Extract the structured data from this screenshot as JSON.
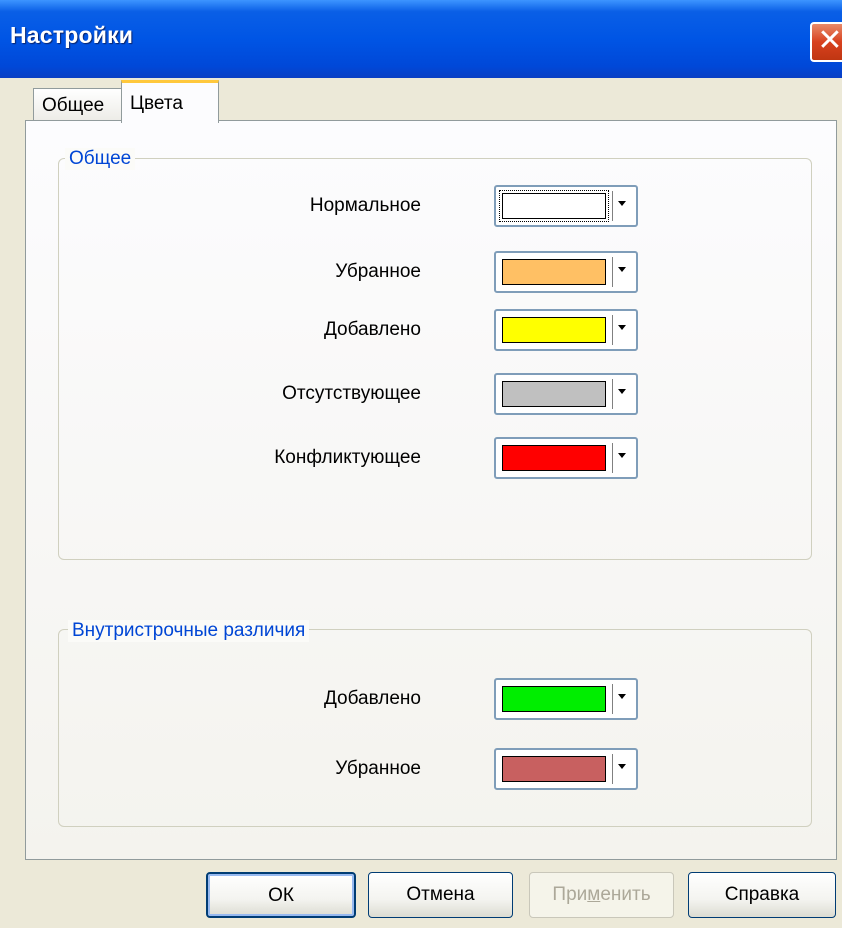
{
  "window": {
    "title": "Настройки",
    "close_glyph": "✕"
  },
  "tabs": [
    {
      "label": "Общее",
      "active": false
    },
    {
      "label": "Цвета",
      "active": true
    }
  ],
  "groups": {
    "general": {
      "legend": "Общее",
      "rows": [
        {
          "label": "Нормальное",
          "color": "#ffffff"
        },
        {
          "label": "Убранное",
          "color": "#ffc064"
        },
        {
          "label": "Добавлено",
          "color": "#ffff00"
        },
        {
          "label": "Отсутствующее",
          "color": "#c0c0c0"
        },
        {
          "label": "Конфликтующее",
          "color": "#ff0000"
        }
      ]
    },
    "inline": {
      "legend": "Внутристрочные различия",
      "rows": [
        {
          "label": "Добавлено",
          "color": "#00ee00"
        },
        {
          "label": "Убранное",
          "color": "#c86060"
        }
      ]
    }
  },
  "buttons": {
    "ok": "ОК",
    "cancel": "Отмена",
    "apply_prefix": "При",
    "apply_underlined": "м",
    "apply_suffix": "енить",
    "help": "Справка"
  },
  "colors": {
    "titlebar": "#0055e5",
    "accent": "#0046d5",
    "tab_highlight": "#ffc83c"
  }
}
